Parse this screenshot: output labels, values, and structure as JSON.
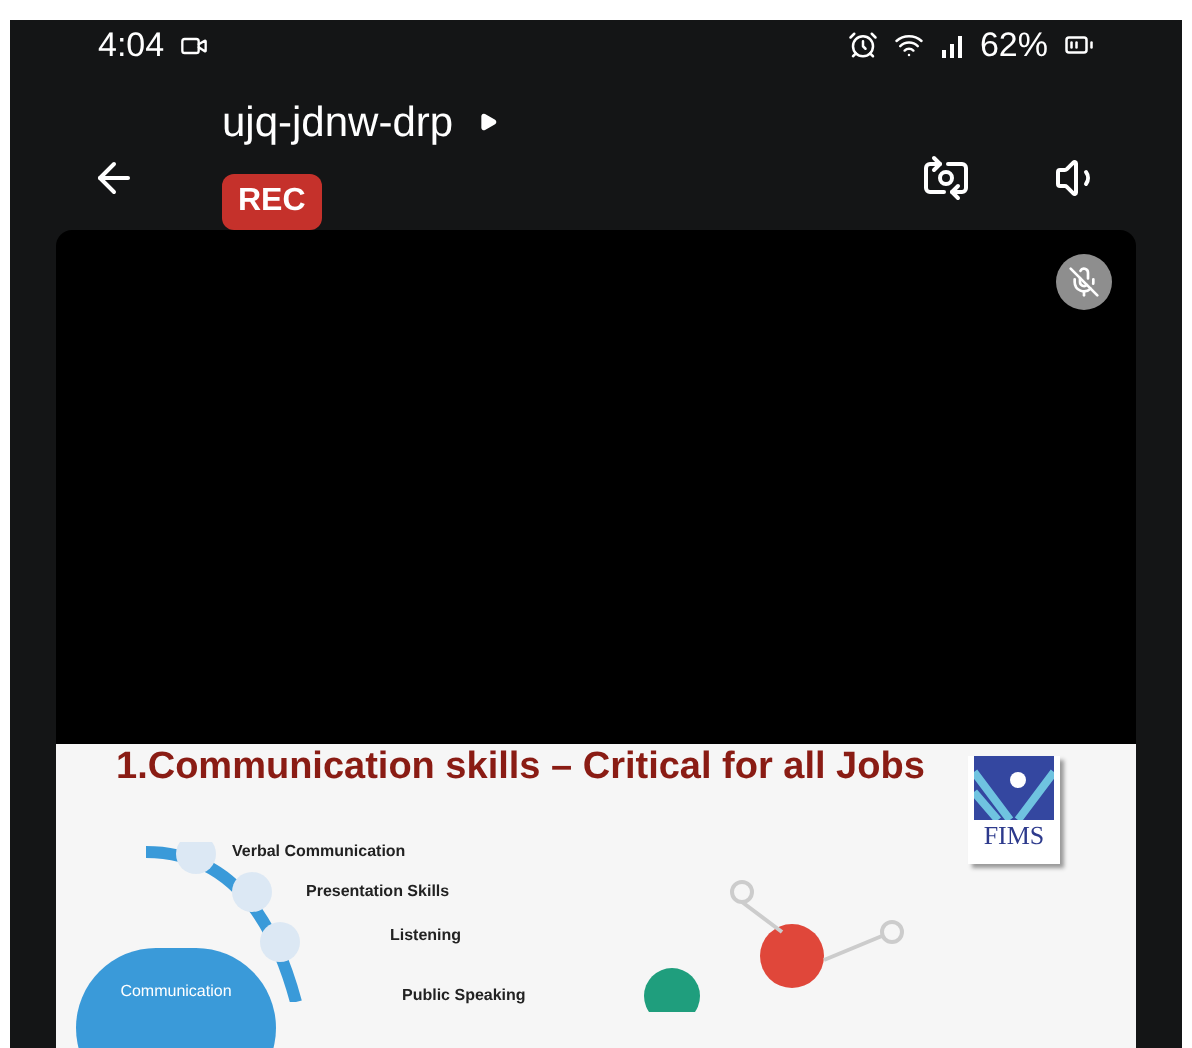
{
  "status_bar": {
    "time": "4:04",
    "battery": "62%"
  },
  "meeting": {
    "title": "ujq-jdnw-drp",
    "rec_badge": "REC"
  },
  "tile": {
    "muted": true
  },
  "slide": {
    "title": "1.Communication skills – Critical for all Jobs",
    "logo_text": "FIMS",
    "hub_label": "Communication",
    "skills": [
      "Verbal Communication",
      "Presentation Skills",
      "Listening",
      "Public Speaking"
    ]
  }
}
